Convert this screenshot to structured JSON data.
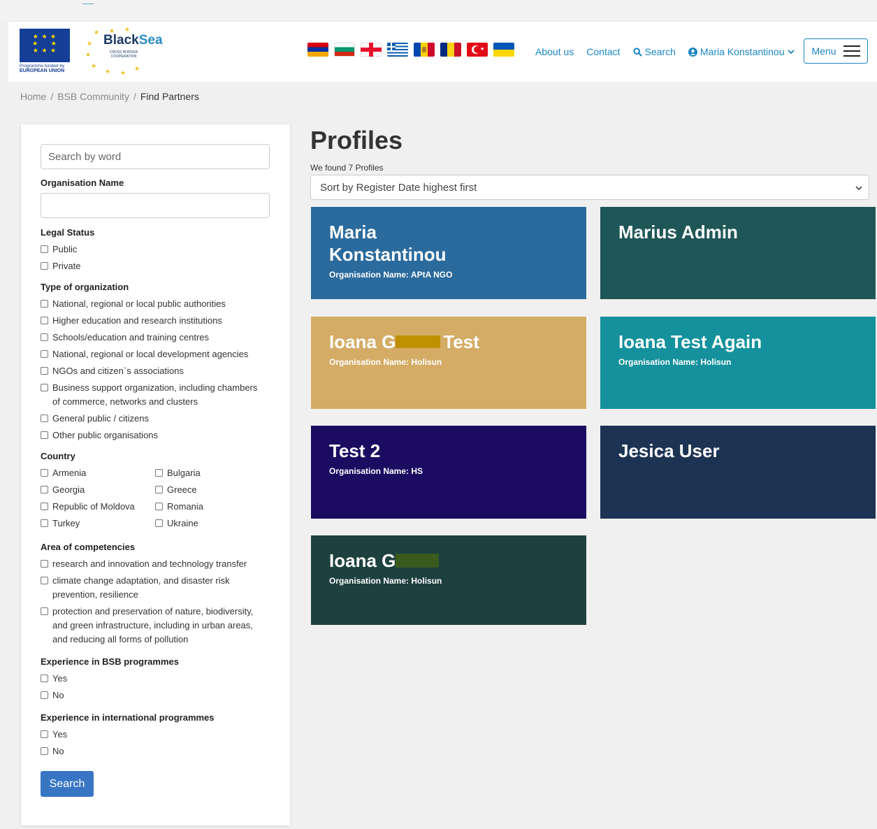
{
  "header": {
    "eu_caption_line1": "Programme funded by",
    "eu_caption_line2": "EUROPEAN UNION",
    "logo_black": "Black",
    "logo_sea": "Sea",
    "logo_sub": "CROSS BORDER COOPERATION",
    "nav": {
      "about": "About us",
      "contact": "Contact",
      "search": "Search",
      "user": "Maria Konstantinou"
    },
    "menu_label": "Menu"
  },
  "flags": [
    "armenia",
    "bulgaria",
    "georgia",
    "greece",
    "moldova",
    "romania",
    "turkey",
    "ukraine"
  ],
  "breadcrumb": {
    "home": "Home",
    "community": "BSB Community",
    "current": "Find Partners"
  },
  "filters": {
    "search_placeholder": "Search by word",
    "org_name_label": "Organisation Name",
    "legal_status_label": "Legal Status",
    "legal_status": [
      "Public",
      "Private"
    ],
    "type_label": "Type of organization",
    "types": [
      "National, regional or local public authorities",
      "Higher education and research institutions",
      "Schools/education and training centres",
      "National, regional or local development agencies",
      "NGOs and citizen`s associations",
      "Business support organization, including chambers of commerce, networks and clusters",
      "General public / citizens",
      "Other public organisations"
    ],
    "country_label": "Country",
    "countries": [
      "Armenia",
      "Bulgaria",
      "Georgia",
      "Greece",
      "Republic of Moldova",
      "Romania",
      "Turkey",
      "Ukraine"
    ],
    "area_label": "Area of competencies",
    "areas": [
      "research and innovation and technology transfer",
      "climate change adaptation, and disaster risk prevention, resilience",
      "protection and preservation of nature, biodiversity, and green infrastructure, including in urban areas, and reducing all forms of pollution"
    ],
    "bsb_label": "Experience in BSB programmes",
    "bsb_options": [
      "Yes",
      "No"
    ],
    "intl_label": "Experience in international programmes",
    "intl_options": [
      "Yes",
      "No"
    ],
    "search_button": "Search"
  },
  "main": {
    "title": "Profiles",
    "found": "We found 7 Profiles",
    "sort_selected": "Sort by Register Date highest first"
  },
  "profiles": [
    {
      "name": "Maria Konstantinou",
      "org": "Organisation Name: APtA NGO",
      "color": "#2b6a9c"
    },
    {
      "name": "Marius Admin",
      "org": "",
      "color": "#1f5657"
    },
    {
      "name_a": "Ioana G",
      "name_b": "Test",
      "org": "Organisation Name: Holisun",
      "color": "#d4ac66",
      "redact": "#bf9000"
    },
    {
      "name": "Ioana Test Again",
      "org": "Organisation Name: Holisun",
      "color": "#14919c"
    },
    {
      "name": "Test 2",
      "org": "Organisation Name: HS",
      "color": "#1b0c62"
    },
    {
      "name": "Jesica User",
      "org": "",
      "color": "#1d3354"
    },
    {
      "name_a": "Ioana G",
      "name_b": "",
      "org": "Organisation Name: Holisun",
      "color": "#1e413f",
      "redact": "#3a5a1e"
    }
  ]
}
